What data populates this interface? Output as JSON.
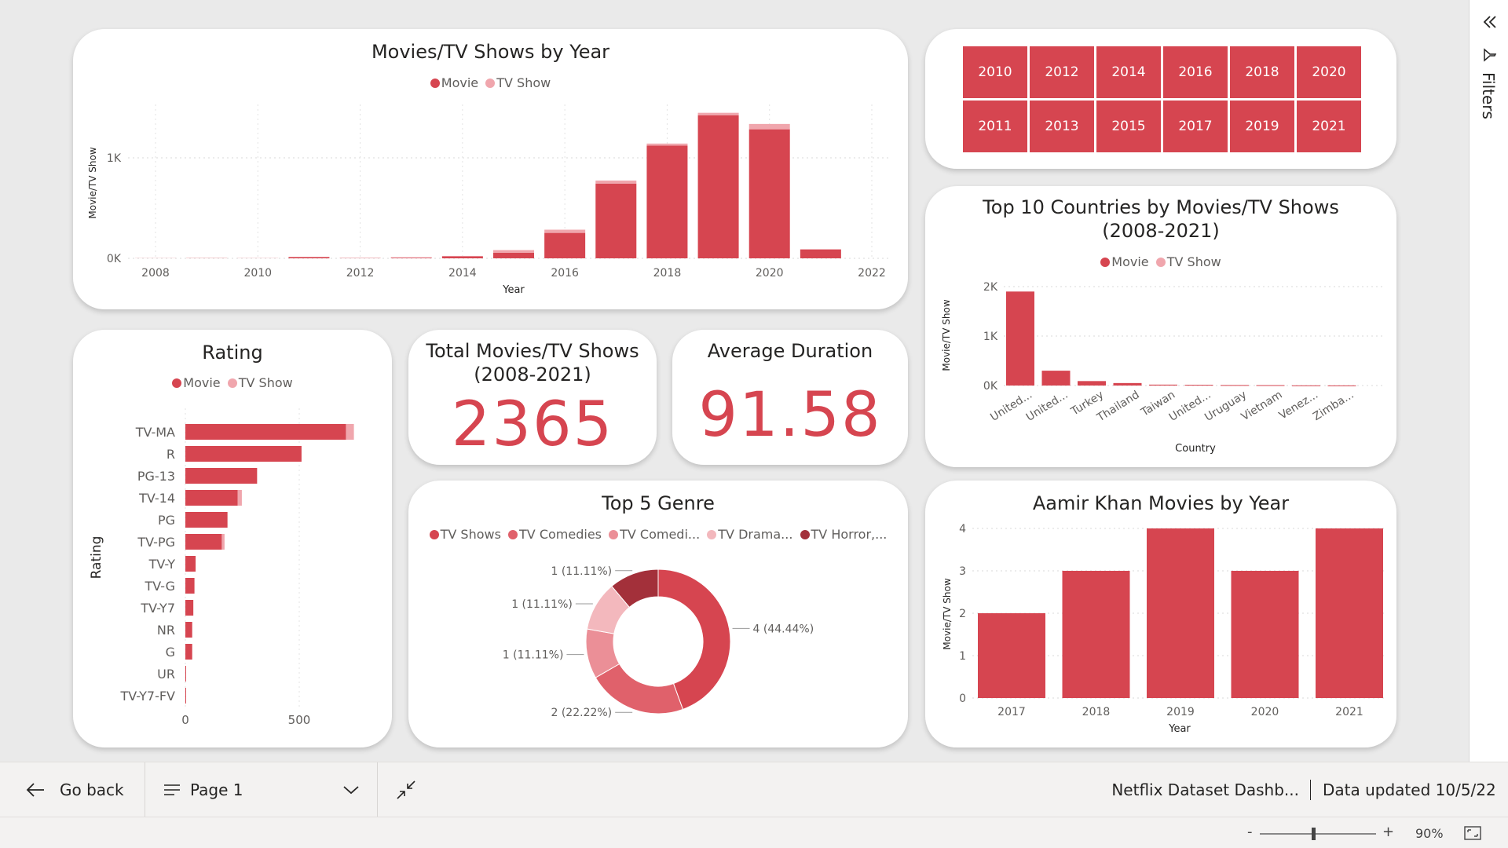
{
  "colors": {
    "movie": "#d64550",
    "tv_show": "#f0a6ad",
    "accent": "#d64550"
  },
  "year_chart": {
    "title": "Movies/TV Shows by Year",
    "legend": [
      "Movie",
      "TV Show"
    ],
    "ylabel": "Movie/TV Show",
    "xlabel": "Year",
    "yticks": [
      "0K",
      "1K"
    ],
    "xticks": [
      "2008",
      "2010",
      "2012",
      "2014",
      "2016",
      "2018",
      "2020",
      "2022"
    ]
  },
  "year_slicer": {
    "years": [
      "2010",
      "2012",
      "2014",
      "2016",
      "2018",
      "2020",
      "2011",
      "2013",
      "2015",
      "2017",
      "2019",
      "2021"
    ]
  },
  "countries_chart": {
    "title_line1": "Top 10 Countries by Movies/TV Shows",
    "title_line2": "(2008-2021)",
    "legend": [
      "Movie",
      "TV Show"
    ],
    "ylabel": "Movie/TV Show",
    "xlabel": "Country",
    "yticks": [
      "0K",
      "1K",
      "2K"
    ]
  },
  "rating_chart": {
    "title": "Rating",
    "legend": [
      "Movie",
      "TV Show"
    ],
    "ylabel": "Rating",
    "xticks": [
      "0",
      "500"
    ]
  },
  "kpi_total": {
    "title_line1": "Total Movies/TV Shows",
    "title_line2": "(2008-2021)",
    "value": "2365"
  },
  "kpi_duration": {
    "title": "Average Duration",
    "value": "91.58"
  },
  "genre_chart": {
    "title": "Top 5 Genre",
    "legend": [
      "TV Shows",
      "TV Comedies",
      "TV Comedi...",
      "TV Drama...",
      "TV Horror,..."
    ],
    "legend_colors": [
      "#d64550",
      "#e0616b",
      "#eb8f97",
      "#f3b8bd",
      "#a3303a"
    ]
  },
  "aamir_chart": {
    "title": "Aamir Khan Movies by Year",
    "ylabel": "Movie/TV Show",
    "xlabel": "Year",
    "yticks": [
      "0",
      "1",
      "2",
      "3",
      "4"
    ]
  },
  "filters_pane": {
    "label": "Filters",
    "collapse_icon": "double-chevron-left-icon",
    "filter_icon": "funnel-icon"
  },
  "footer": {
    "go_back": "Go back",
    "page": "Page 1",
    "report_name": "Netflix Dataset Dashb...",
    "data_updated": "Data updated 10/5/22"
  },
  "statusbar": {
    "zoom_minus": "-",
    "zoom_plus": "+",
    "zoom_level": "90%"
  },
  "chart_data": [
    {
      "type": "bar",
      "title": "Movies/TV Shows by Year",
      "xlabel": "Year",
      "ylabel": "Movie/TV Show",
      "x": [
        2008,
        2009,
        2010,
        2011,
        2012,
        2013,
        2014,
        2015,
        2016,
        2017,
        2018,
        2019,
        2020,
        2021
      ],
      "series": [
        {
          "name": "Movie",
          "values": [
            1,
            2,
            1,
            13,
            3,
            6,
            19,
            56,
            253,
            744,
            1121,
            1424,
            1284,
            88
          ]
        },
        {
          "name": "TV Show",
          "values": [
            0,
            0,
            1,
            0,
            1,
            5,
            5,
            26,
            32,
            30,
            21,
            24,
            53,
            4
          ]
        }
      ],
      "ylim": [
        0,
        1500
      ],
      "stacked": true
    },
    {
      "type": "bar",
      "title": "Top 10 Countries by Movies/TV Shows (2008-2021)",
      "xlabel": "Country",
      "ylabel": "Movie/TV Show",
      "categories": [
        "United...",
        "United...",
        "Turkey",
        "Thailand",
        "Taiwan",
        "United...",
        "Uruguay",
        "Vietnam",
        "Venez...",
        "Zimba..."
      ],
      "series": [
        {
          "name": "Movie",
          "values": [
            1900,
            300,
            90,
            50,
            18,
            15,
            10,
            8,
            3,
            2
          ]
        },
        {
          "name": "TV Show",
          "values": [
            0,
            0,
            0,
            0,
            0,
            0,
            0,
            0,
            0,
            0
          ]
        }
      ],
      "ylim": [
        0,
        2000
      ],
      "stacked": true
    },
    {
      "type": "bar",
      "orientation": "horizontal",
      "title": "Rating",
      "ylabel": "Rating",
      "categories": [
        "TV-MA",
        "R",
        "PG-13",
        "TV-14",
        "PG",
        "TV-PG",
        "TV-Y",
        "TV-G",
        "TV-Y7",
        "NR",
        "G",
        "UR",
        "TV-Y7-FV"
      ],
      "series": [
        {
          "name": "Movie",
          "values": [
            705,
            510,
            315,
            230,
            185,
            160,
            45,
            40,
            35,
            30,
            30,
            3,
            2
          ]
        },
        {
          "name": "TV Show",
          "values": [
            35,
            0,
            0,
            18,
            0,
            12,
            0,
            0,
            0,
            0,
            0,
            0,
            0
          ]
        }
      ],
      "xlim": [
        0,
        800
      ],
      "stacked": true
    },
    {
      "type": "pie",
      "title": "Top 5 Genre",
      "categories": [
        "TV Shows",
        "TV Comedies",
        "TV Comedi...",
        "TV Drama...",
        "TV Horror,..."
      ],
      "values": [
        4,
        2,
        1,
        1,
        1
      ],
      "labels": [
        "4 (44.44%)",
        "2 (22.22%)",
        "1 (11.11%)",
        "1 (11.11%)",
        "1 (11.11%)"
      ],
      "donut": true
    },
    {
      "type": "bar",
      "title": "Aamir Khan Movies by Year",
      "xlabel": "Year",
      "ylabel": "Movie/TV Show",
      "categories": [
        "2017",
        "2018",
        "2019",
        "2020",
        "2021"
      ],
      "values": [
        2,
        3,
        4,
        3,
        4
      ],
      "ylim": [
        0,
        4
      ]
    }
  ]
}
